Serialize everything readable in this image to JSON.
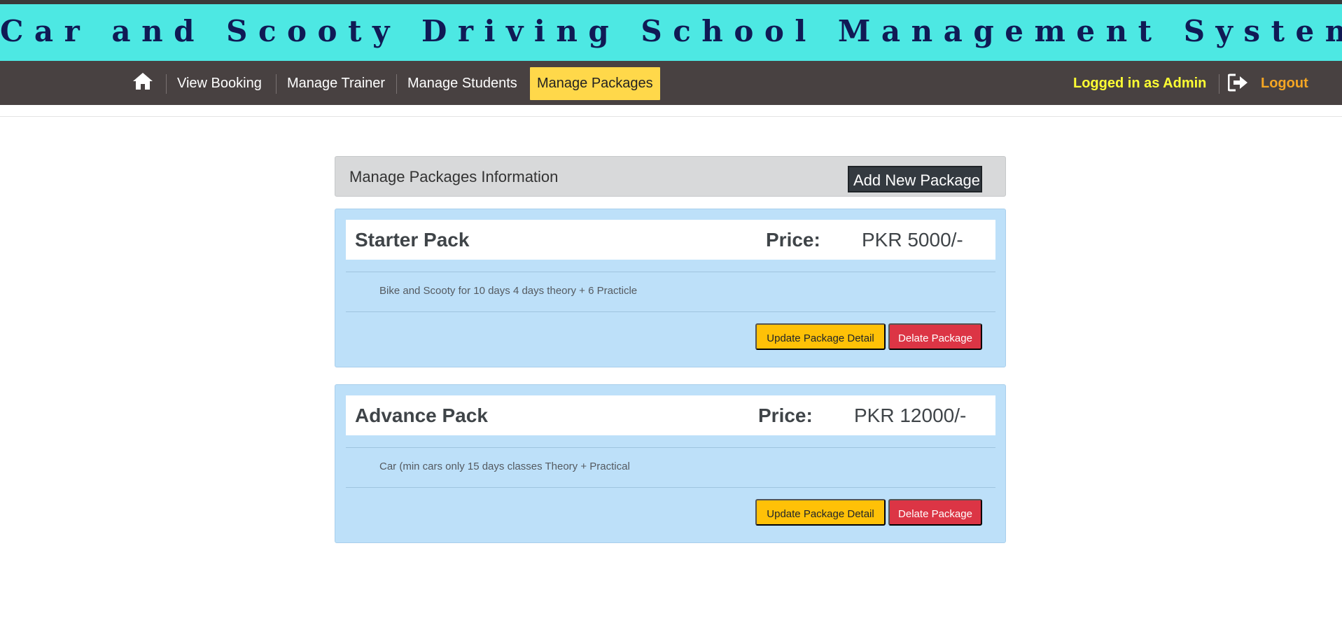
{
  "app": {
    "title": "Car and Scooty Driving School Management System"
  },
  "nav": {
    "home_icon": "home-icon",
    "items": [
      {
        "label": "View Booking",
        "active": false
      },
      {
        "label": "Manage Trainer",
        "active": false
      },
      {
        "label": "Manage Students",
        "active": false
      },
      {
        "label": "Manage Packages",
        "active": true
      }
    ],
    "logged_in_text": "Logged in as Admin",
    "logout_icon": "sign-out-icon",
    "logout_label": "Logout"
  },
  "section": {
    "title": "Manage Packages Information",
    "add_button": "Add New Package"
  },
  "packages": [
    {
      "name": "Starter Pack",
      "price_label": "Price:",
      "price": "PKR 5000/-",
      "description": "Bike and Scooty for 10 days 4 days theory + 6 Practicle",
      "update_label": "Update Package Detail",
      "delete_label": "Delate Package"
    },
    {
      "name": "Advance Pack",
      "price_label": "Price:",
      "price": "PKR 12000/-",
      "description": "Car (min cars only 15 days classes Theory + Practical",
      "update_label": "Update Package Detail",
      "delete_label": "Delate Package"
    }
  ],
  "colors": {
    "title_bar": "#4de8e3",
    "title_text": "#101a55",
    "navbar": "#484141",
    "active_nav": "#ffd84a",
    "logged_in": "#ffff33",
    "logout": "#f5a623",
    "card_bg": "#bde0f9",
    "update_button": "#ffc107",
    "delete_button": "#dc3545"
  }
}
